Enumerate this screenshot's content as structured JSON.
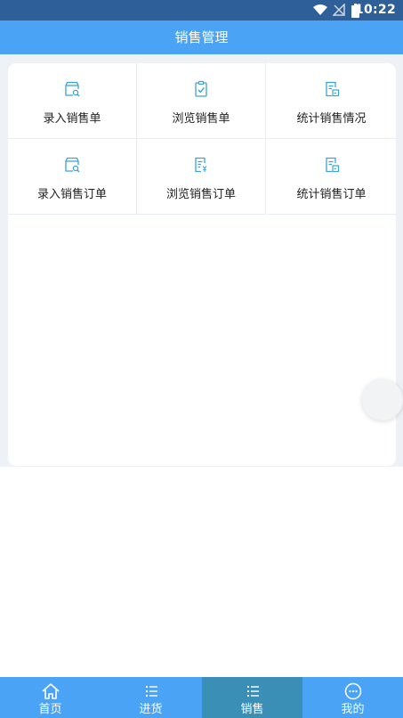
{
  "status_bar": {
    "time": "10:22",
    "icons": [
      "wifi-icon",
      "no-signal-icon",
      "battery-icon"
    ]
  },
  "header": {
    "title": "销售管理"
  },
  "menu": [
    {
      "label": "录入销售单",
      "icon": "cart-search-icon"
    },
    {
      "label": "浏览销售单",
      "icon": "clipboard-check-icon"
    },
    {
      "label": "统计销售情况",
      "icon": "report-icon"
    },
    {
      "label": "录入销售订单",
      "icon": "cart-search-icon"
    },
    {
      "label": "浏览销售订单",
      "icon": "list-yuan-icon"
    },
    {
      "label": "统计销售订单",
      "icon": "report-icon"
    }
  ],
  "tabs": [
    {
      "label": "首页",
      "icon": "home-icon",
      "active": false
    },
    {
      "label": "进货",
      "icon": "list-icon",
      "active": false
    },
    {
      "label": "销售",
      "icon": "list-icon",
      "active": true
    },
    {
      "label": "我的",
      "icon": "chat-dots-icon",
      "active": false
    }
  ],
  "colors": {
    "status_bar": "#2f5f98",
    "header": "#4aa3f4",
    "tab_bar": "#4aa3f4",
    "tab_active": "#3a8fb7",
    "icon": "#3aa3d8"
  }
}
